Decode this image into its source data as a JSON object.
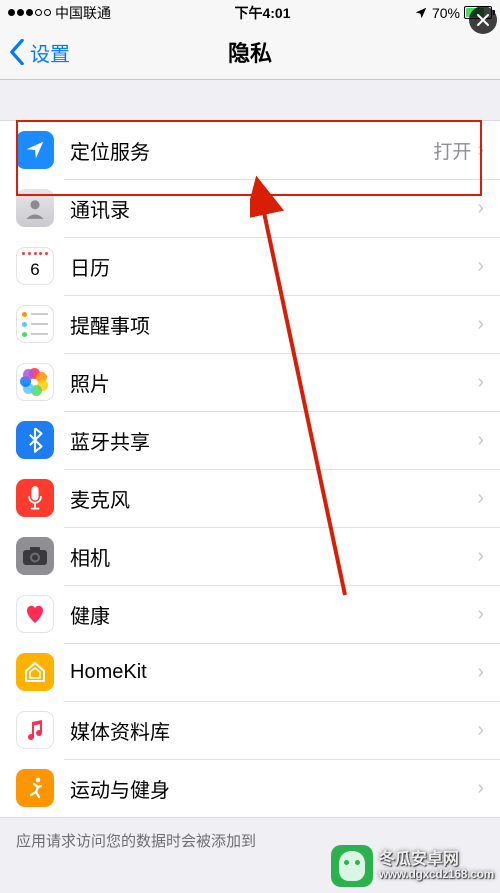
{
  "status": {
    "carrier": "中国联通",
    "time": "下午4:01",
    "battery_pct": "70%"
  },
  "nav": {
    "back_label": "设置",
    "title": "隐私"
  },
  "rows": [
    {
      "key": "location",
      "label": "定位服务",
      "value": "打开"
    },
    {
      "key": "contacts",
      "label": "通讯录",
      "value": ""
    },
    {
      "key": "calendar",
      "label": "日历",
      "value": ""
    },
    {
      "key": "reminders",
      "label": "提醒事项",
      "value": ""
    },
    {
      "key": "photos",
      "label": "照片",
      "value": ""
    },
    {
      "key": "bluetooth",
      "label": "蓝牙共享",
      "value": ""
    },
    {
      "key": "mic",
      "label": "麦克风",
      "value": ""
    },
    {
      "key": "camera",
      "label": "相机",
      "value": ""
    },
    {
      "key": "health",
      "label": "健康",
      "value": ""
    },
    {
      "key": "homekit",
      "label": "HomeKit",
      "value": ""
    },
    {
      "key": "media",
      "label": "媒体资料库",
      "value": ""
    },
    {
      "key": "motion",
      "label": "运动与健身",
      "value": ""
    }
  ],
  "footer": "应用请求访问您的数据时会被添加到",
  "watermark": {
    "line1": "冬瓜安卓网",
    "line2": "www.dgxcdz168.com"
  }
}
